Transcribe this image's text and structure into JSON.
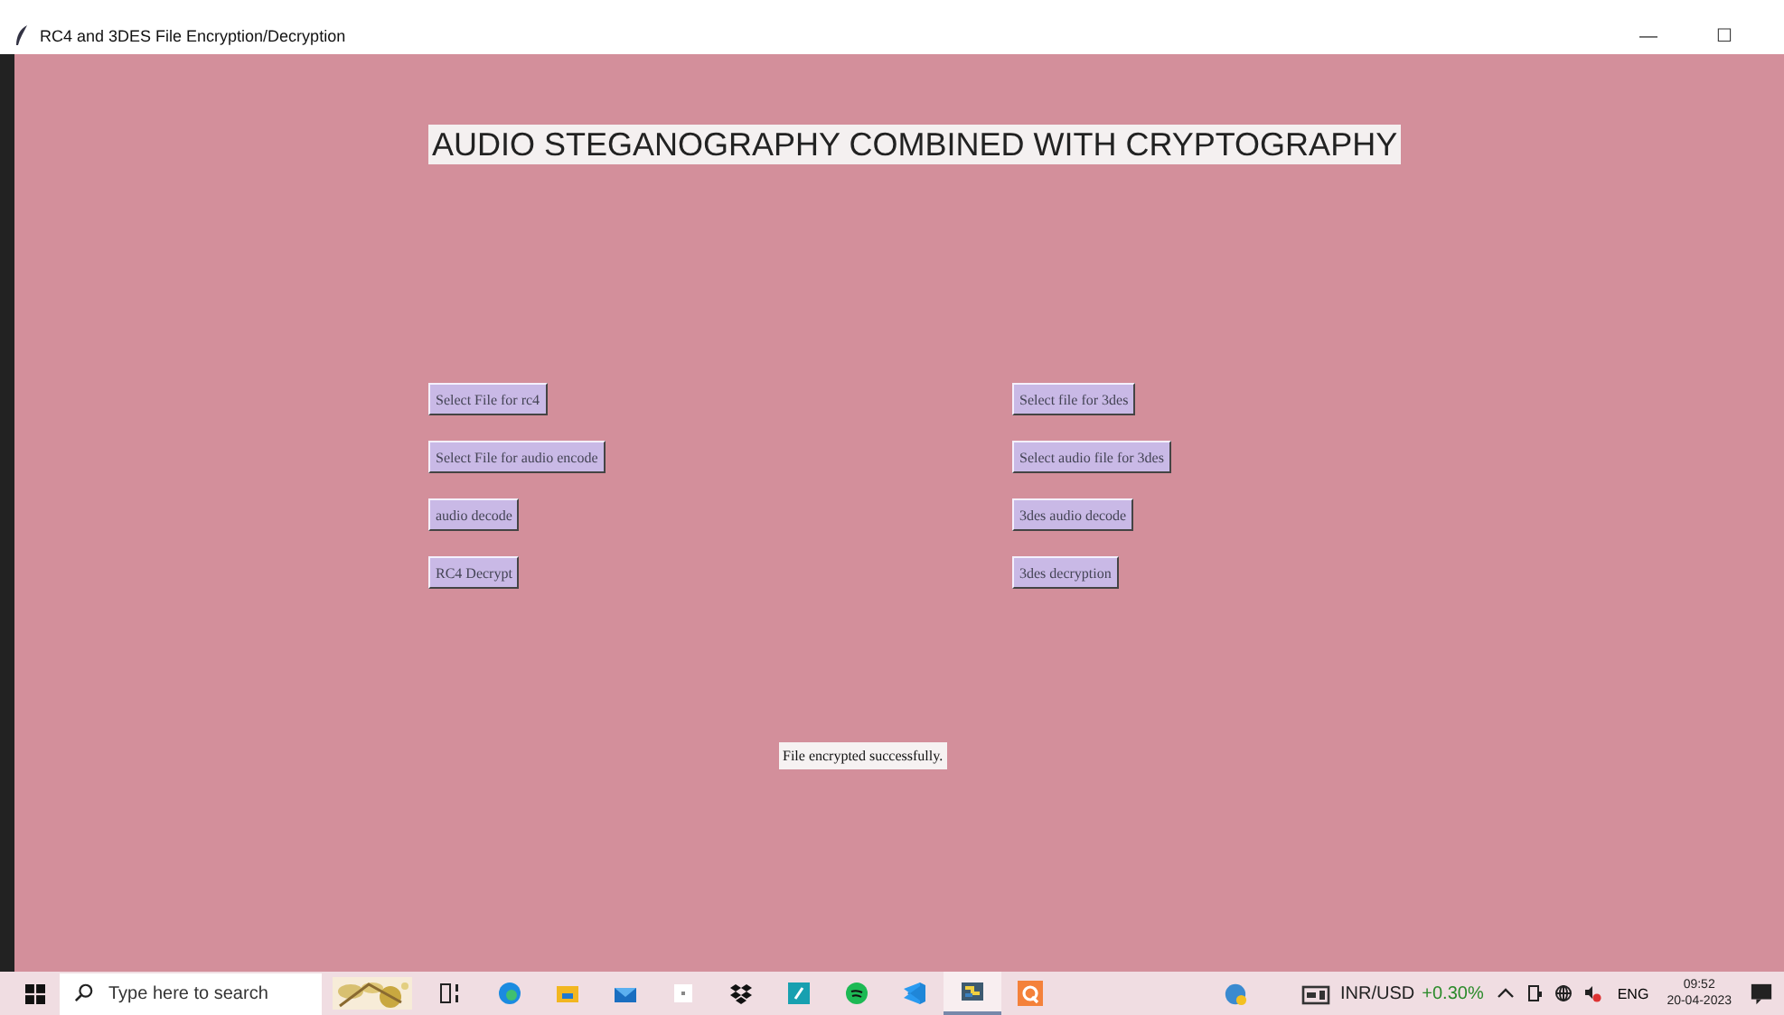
{
  "window": {
    "title": "RC4 and 3DES File Encryption/Decryption",
    "controls": [
      "—",
      "☐"
    ]
  },
  "heading": "AUDIO STEGANOGRAPHY COMBINED WITH CRYPTOGRAPHY",
  "left_buttons": [
    "Select File for rc4",
    "Select File for audio encode",
    "audio decode",
    "RC4 Decrypt"
  ],
  "right_buttons": [
    "Select file for 3des",
    "Select audio file for 3des",
    "3des audio decode",
    "3des decryption"
  ],
  "status": "File encrypted successfully.",
  "taskbar": {
    "search": {
      "placeholder": "Type here to search"
    },
    "apps": [
      {
        "kind": "taskview",
        "active": false
      },
      {
        "kind": "edge",
        "active": false
      },
      {
        "kind": "folder",
        "active": false
      },
      {
        "kind": "mail",
        "active": false
      },
      {
        "kind": "tile",
        "active": false
      },
      {
        "kind": "dropbox",
        "active": false
      },
      {
        "kind": "app",
        "active": false
      },
      {
        "kind": "spotify",
        "active": false
      },
      {
        "kind": "vscode",
        "active": false
      },
      {
        "kind": "python",
        "active": true
      },
      {
        "kind": "q",
        "active": false
      }
    ],
    "ticker": {
      "pair": "INR/USD",
      "change": "+0.30%"
    },
    "language": "ENG",
    "time": "09:52",
    "date": "20-04-2023"
  }
}
